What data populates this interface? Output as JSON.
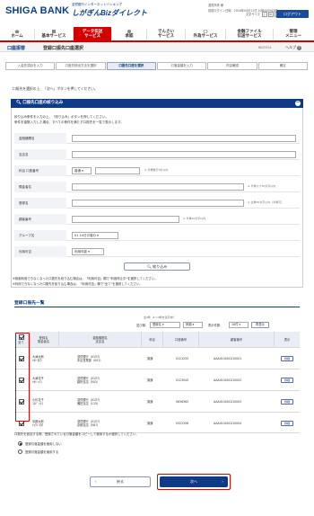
{
  "header": {
    "bank_logo": "SHIGA BANK",
    "service_sub": "滋賀銀行インターネットバンキング",
    "service_logo": "しがぎんBizダイレクト",
    "company": "滋賀商事 様",
    "last_login": "前回ログイン日時：2016年04月11日 10時40分02秒",
    "font_size_label": "文字サイズ",
    "font_size_small": "小",
    "font_size_mid": "中",
    "font_size_large": "大",
    "logout": "ログアウト"
  },
  "nav": {
    "items": [
      {
        "label1": "ホーム",
        "label2": ""
      },
      {
        "label1": "基本サービス",
        "label2": ""
      },
      {
        "label1": "データ伝送",
        "label2": "サービス"
      },
      {
        "label1": "承認",
        "label2": ""
      },
      {
        "label1": "でんさい",
        "label2": "サービス"
      },
      {
        "label1": "外為サービス",
        "label2": ""
      },
      {
        "label1": "金融ファイル",
        "label2": "伝送サービス"
      },
      {
        "label1": "管理",
        "label2": "メニュー"
      }
    ]
  },
  "page": {
    "crumb": "口座振替",
    "title": "登録口振先口座選択",
    "screen_id": "BKZF004",
    "help": "ヘルプ",
    "instruction": "口振先を選択の上、「次へ」ボタンを押してください。"
  },
  "steps": [
    "入金先項目を入力",
    "口座先検出方法を選択",
    "口振先口座を選択",
    "引落金額を入力",
    "内容確認",
    "確定"
  ],
  "filter": {
    "title": "口振先口座の絞り込み",
    "desc1": "絞り込み条件を入力の上、「絞り込み」ボタンを押してください。",
    "desc2": "条件を複数入力した場合、すべての条件を満たす口振先を一覧で表示します。",
    "fields": [
      {
        "label": "金融機関名",
        "note": ""
      },
      {
        "label": "支店名",
        "note": ""
      },
      {
        "label": "科目 口座番号",
        "note": "※ 半角数字7桁以内",
        "select": "普通"
      },
      {
        "label": "預金者名",
        "note": "※ 半角カナ30文字以内"
      },
      {
        "label": "登録名",
        "note": "※ 全角30文字以内（半角可）"
      },
      {
        "label": "顧客番号",
        "note": "※ 半角20文字以内"
      },
      {
        "label": "グループ名",
        "note": "",
        "select": "01 10日引落分"
      },
      {
        "label": "利用可否",
        "note": "",
        "select": "利用可能"
      }
    ],
    "narrow_button": "絞り込み",
    "note1": "※検索利用できなくなった口振先を絞り込む場合は、「利用可否」欄で\"利用停止中\"を選択してください。",
    "note2": "※利用できなくなった口振先を絞り込む場合は、「利用可否」欄で\"全て\"を選択してください。"
  },
  "list": {
    "title": "登録口振先一覧",
    "pager": "全4件（1〜4件を表示中）",
    "sort_label": "並び順：",
    "sort_key": "登録名",
    "sort_order": "昇順",
    "count_label": "表示件数：",
    "count_value": "10件",
    "redisplay": "再表示",
    "headers": {
      "all": "全て",
      "reg_name": "登録名",
      "depositor": "預金者名",
      "bank_name": "金融機関名",
      "branch_name": "支店名",
      "subject": "科目",
      "account": "口座番号",
      "customer": "顧客番号",
      "view": "表示"
    },
    "rows": [
      {
        "reg": "大津太郎",
        "dep": "ｵｵﾂ ﾀﾛｳ",
        "bank": "滋賀銀行（0157）",
        "branch": "本店営業部（001）",
        "subj": "普通",
        "acct": "0121233",
        "cust": "AAA01000C010001",
        "btn": "詳細"
      },
      {
        "reg": "大津花子",
        "dep": "ｵｵﾂ ﾊﾅｺ",
        "bank": "滋賀銀行（0157）",
        "branch": "膳所支店（002）",
        "subj": "普通",
        "acct": "0123045",
        "cust": "AAA01000C010002",
        "btn": "詳細"
      },
      {
        "reg": "小杉花子",
        "dep": "ｺｽｷﾞ ﾊﾅｺ",
        "bank": "滋賀銀行（0157）",
        "branch": "瀬田支店（115）",
        "subj": "普通",
        "acct": "0636363",
        "cust": "AAA01000C010003",
        "btn": "詳細"
      },
      {
        "reg": "京都太郎",
        "dep": "ｷｮｳﾄ ﾀﾛｳ",
        "bank": "滋賀銀行（0157）",
        "branch": "京都支店（087）",
        "subj": "普通",
        "acct": "0322356",
        "cust": "AAA01000C010004",
        "btn": "詳細"
      }
    ]
  },
  "option": {
    "question": "口振先を追加する際、登録されている引落金額をコピーして使用するか選択してください。",
    "opt1": "登録引落金額を使用しない",
    "opt2": "登録引落金額を使用する"
  },
  "footer": {
    "back": "戻る",
    "next": "次へ"
  }
}
